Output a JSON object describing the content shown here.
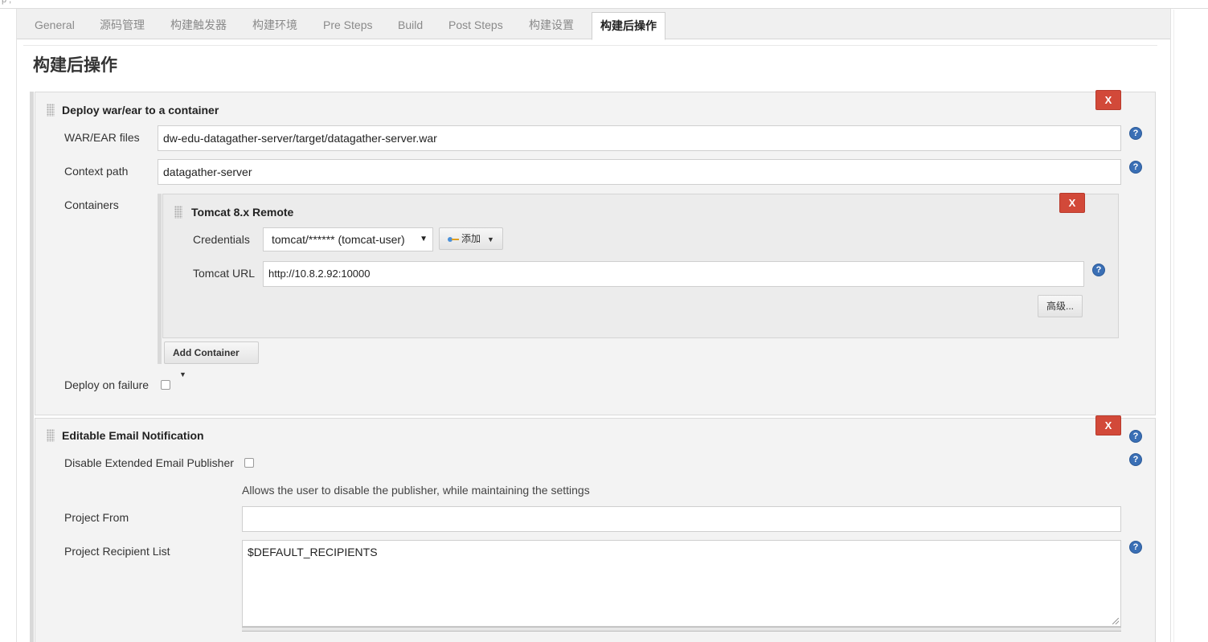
{
  "top_fragment": "p ,",
  "tabs": [
    {
      "label": "General"
    },
    {
      "label": "源码管理"
    },
    {
      "label": "构建触发器"
    },
    {
      "label": "构建环境"
    },
    {
      "label": "Pre Steps"
    },
    {
      "label": "Build"
    },
    {
      "label": "Post Steps"
    },
    {
      "label": "构建设置"
    },
    {
      "label": "构建后操作"
    }
  ],
  "section_title": "构建后操作",
  "deploy": {
    "title": "Deploy war/ear to a container",
    "remove_label": "X",
    "war_label": "WAR/EAR files",
    "war_value": "dw-edu-datagather-server/target/datagather-server.war",
    "context_label": "Context path",
    "context_value": "datagather-server",
    "containers_label": "Containers",
    "container": {
      "title": "Tomcat 8.x Remote",
      "remove_label": "X",
      "credentials_label": "Credentials",
      "credentials_value": "tomcat/****** (tomcat-user)",
      "add_label": "添加",
      "url_label": "Tomcat URL",
      "url_value": "http://10.8.2.92:10000",
      "advanced_label": "高级..."
    },
    "add_container_label": "Add Container",
    "deploy_failure_label": "Deploy on failure",
    "deploy_failure_checked": false
  },
  "email": {
    "title": "Editable Email Notification",
    "remove_label": "X",
    "disable_label": "Disable Extended Email Publisher",
    "disable_checked": false,
    "disable_desc": "Allows the user to disable the publisher, while maintaining the settings",
    "project_from_label": "Project From",
    "project_from_value": "",
    "recipient_label": "Project Recipient List",
    "recipient_value": "$DEFAULT_RECIPIENTS"
  },
  "help_glyph": "?",
  "colors": {
    "remove_button": "#d24939",
    "help_icon": "#3a6fb5",
    "panel_bg": "#f3f3f3"
  }
}
